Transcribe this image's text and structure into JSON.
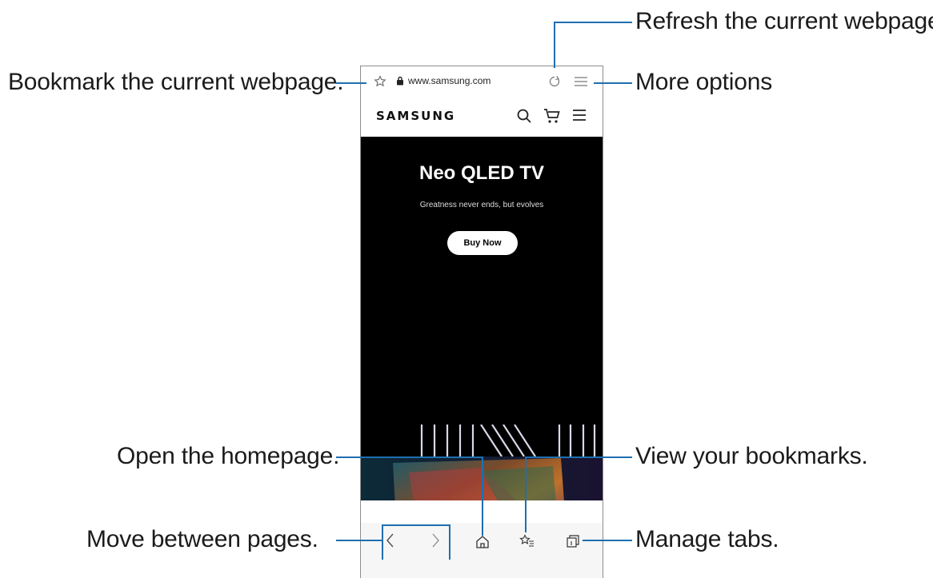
{
  "callouts": {
    "refresh": "Refresh the current webpage.",
    "bookmark": "Bookmark the current webpage.",
    "more_options": "More options",
    "homepage": "Open the homepage.",
    "bookmarks": "View your bookmarks.",
    "move_pages": "Move between pages.",
    "manage_tabs": "Manage tabs."
  },
  "browser": {
    "url": "www.samsung.com"
  },
  "site": {
    "logo": "SAMSUNG"
  },
  "hero": {
    "title": "Neo QLED TV",
    "subtitle": "Greatness never ends, but evolves",
    "cta": "Buy Now"
  },
  "carousel": {
    "dots": 4,
    "active_dot": 2
  },
  "icons": {
    "bookmark_add": "star-outline-icon",
    "lock": "lock-icon",
    "refresh": "refresh-icon",
    "menu": "hamburger-icon",
    "search": "search-icon",
    "cart": "cart-icon",
    "back": "chevron-left-icon",
    "forward": "chevron-right-icon",
    "home": "home-icon",
    "bookmarks": "bookmarks-icon",
    "tabs": "tabs-icon"
  },
  "colors": {
    "leader": "#1f6fb0",
    "hero_bg": "#000000"
  }
}
